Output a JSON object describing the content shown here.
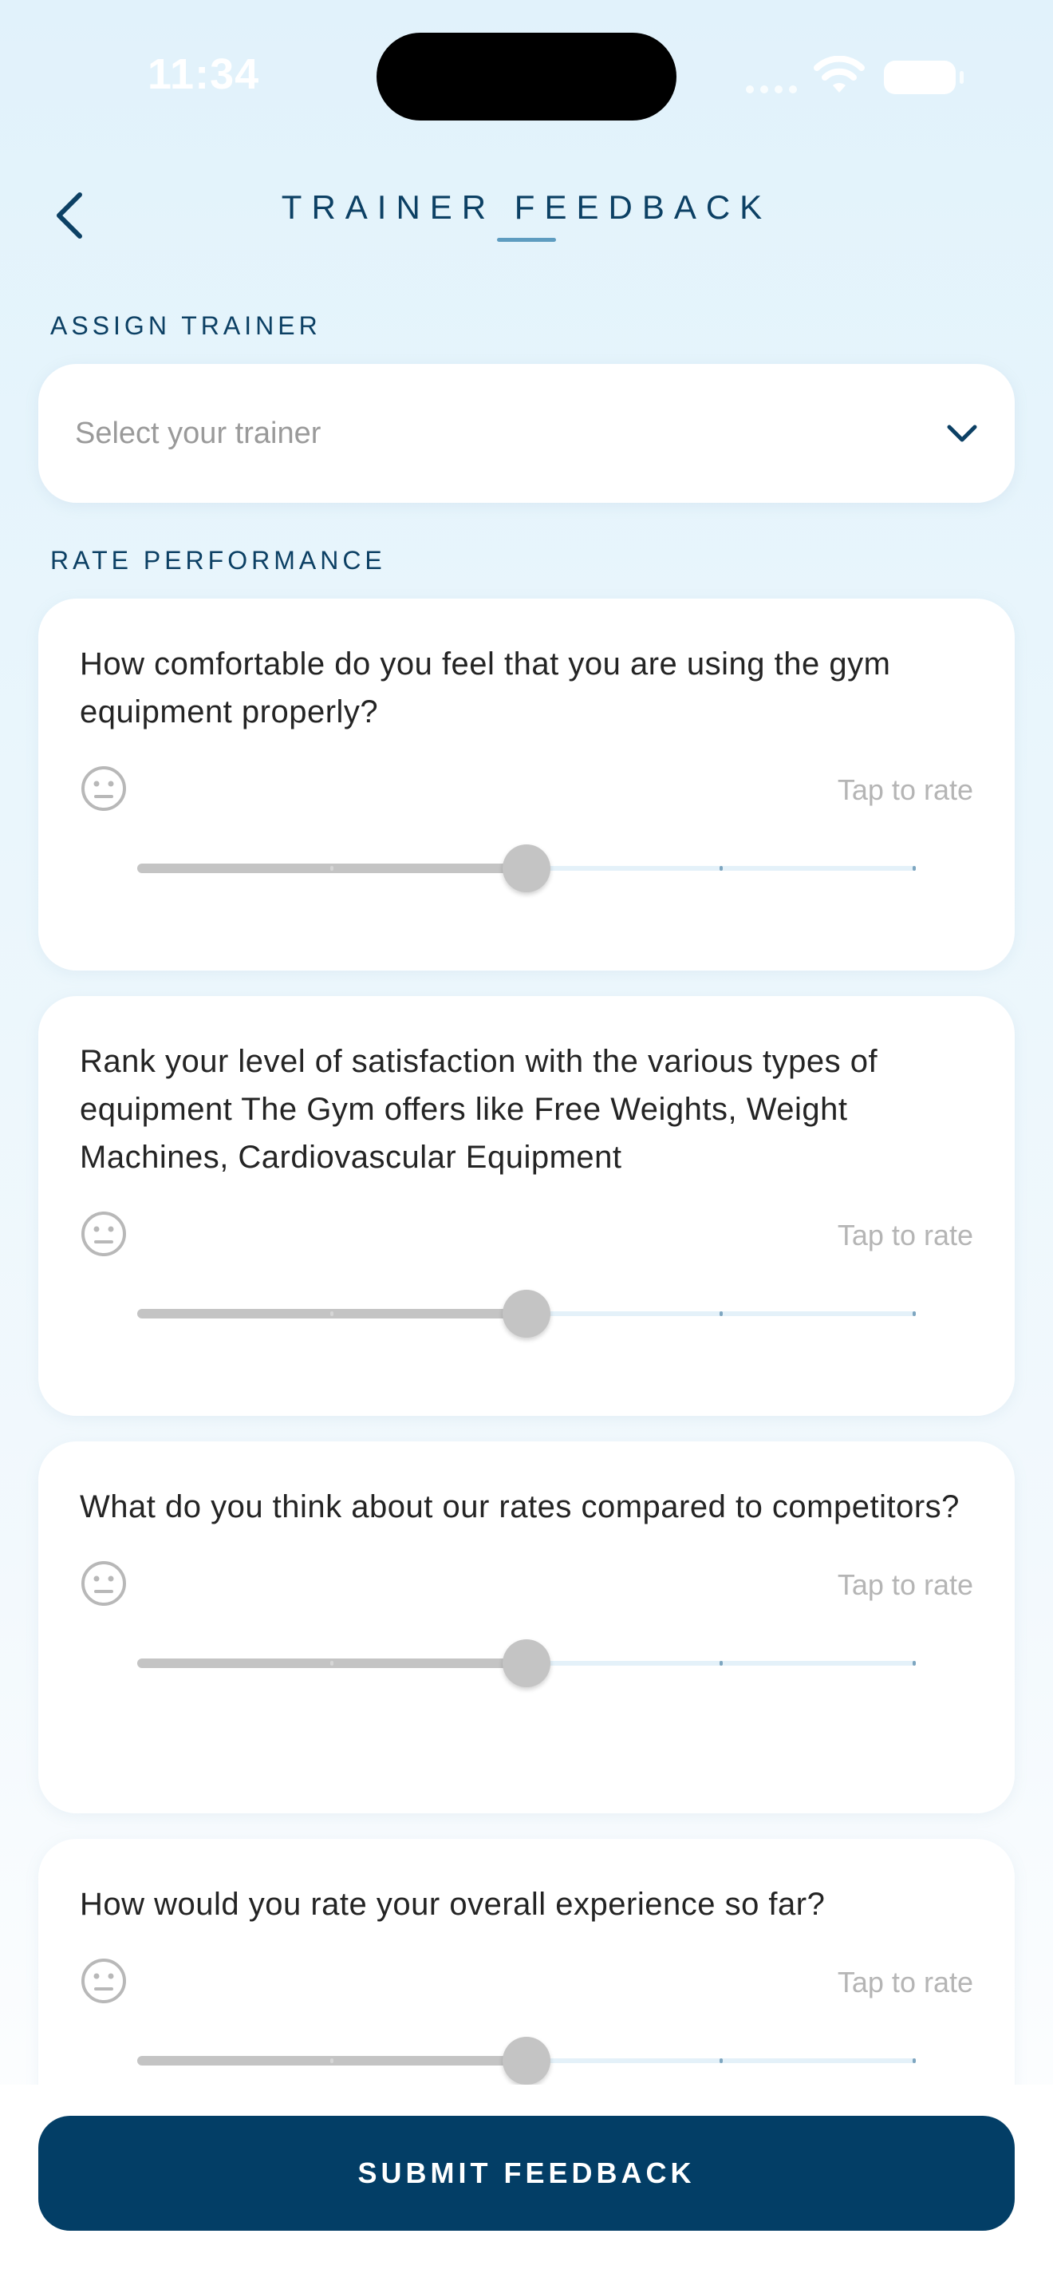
{
  "status_bar": {
    "time": "11:34"
  },
  "header": {
    "title": "TRAINER FEEDBACK",
    "back_icon": "chevron-left-icon"
  },
  "assign": {
    "label": "ASSIGN TRAINER",
    "select_placeholder": "Select your trainer",
    "select_icon": "chevron-down-icon"
  },
  "rate": {
    "label": "RATE PERFORMANCE",
    "hint": "Tap to rate",
    "face_icon": "neutral-face-icon",
    "questions": [
      {
        "text": "How comfortable do you feel that you are using the gym equipment properly?",
        "value": 3,
        "min": 1,
        "max": 5
      },
      {
        "text": "Rank your level of satisfaction with the various types of equipment The Gym offers like Free Weights, Weight Machines, Cardiovascular Equipment",
        "value": 3,
        "min": 1,
        "max": 5
      },
      {
        "text": "What do you think about our rates compared to competitors?",
        "value": 3,
        "min": 1,
        "max": 5
      },
      {
        "text": "How would you rate your overall experience so far?",
        "value": 3,
        "min": 1,
        "max": 5
      }
    ]
  },
  "footer": {
    "submit_label": "SUBMIT FEEDBACK"
  },
  "colors": {
    "primary": "#033e66",
    "title": "#0c4064",
    "muted": "#b5b5b5",
    "slider_gray": "#c4c4c4"
  }
}
